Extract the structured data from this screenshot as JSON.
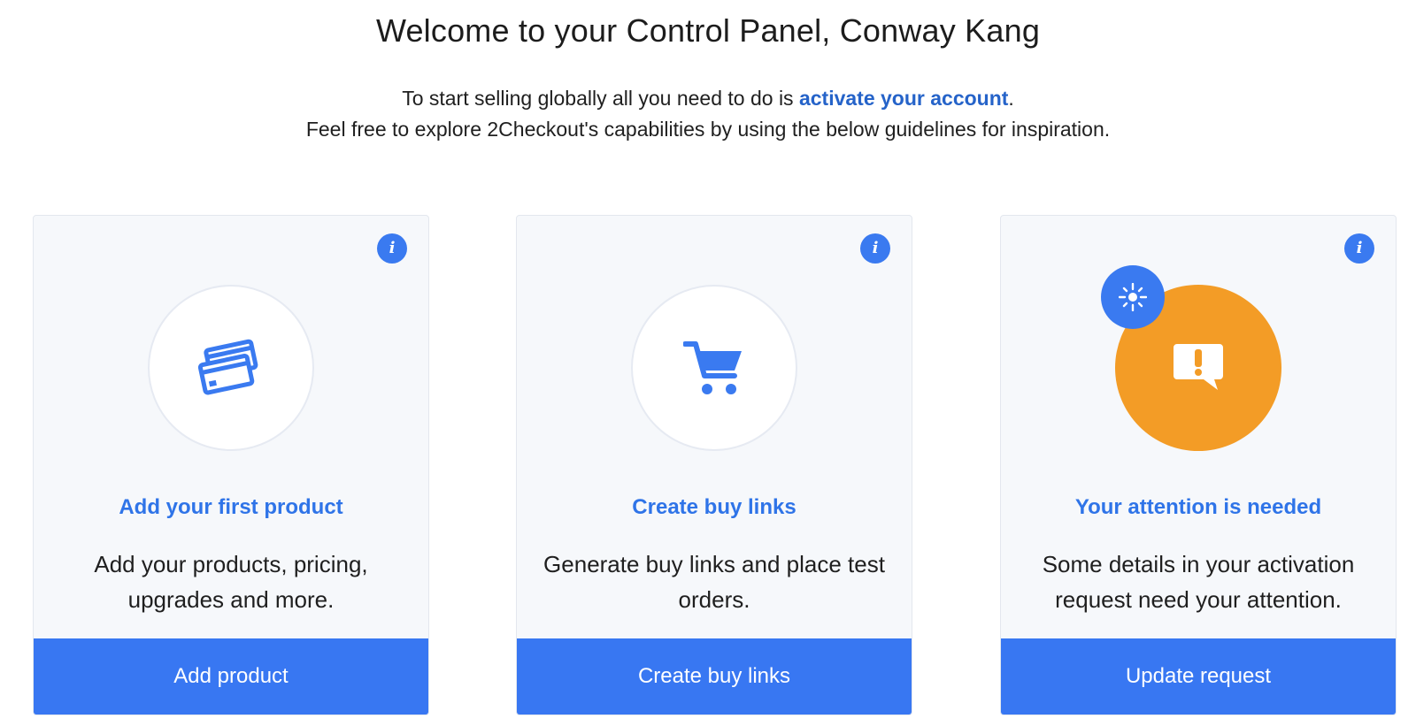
{
  "header": {
    "title": "Welcome to your Control Panel, Conway Kang",
    "line1_prefix": "To start selling globally all you need to do is ",
    "line1_link": "activate your account",
    "line1_suffix": ".",
    "line2": "Feel free to explore 2Checkout's capabilities by using the below guidelines for inspiration."
  },
  "colors": {
    "accent": "#3877f2",
    "link": "#2563c9",
    "attention": "#f39c26",
    "card_bg": "#f6f8fb"
  },
  "cards": [
    {
      "title": "Add your first product",
      "description": "Add your products, pricing, upgrades and more.",
      "button": "Add product",
      "icon": "credit-cards-icon",
      "info_icon_glyph": "i"
    },
    {
      "title": "Create buy links",
      "description": "Generate buy links and place test orders.",
      "button": "Create buy links",
      "icon": "shopping-cart-icon",
      "info_icon_glyph": "i"
    },
    {
      "title": "Your attention is needed",
      "description": "Some details in your activation request need your attention.",
      "button": "Update request",
      "icon": "alert-message-icon",
      "badge_icon": "sparkle-icon",
      "info_icon_glyph": "i"
    }
  ]
}
